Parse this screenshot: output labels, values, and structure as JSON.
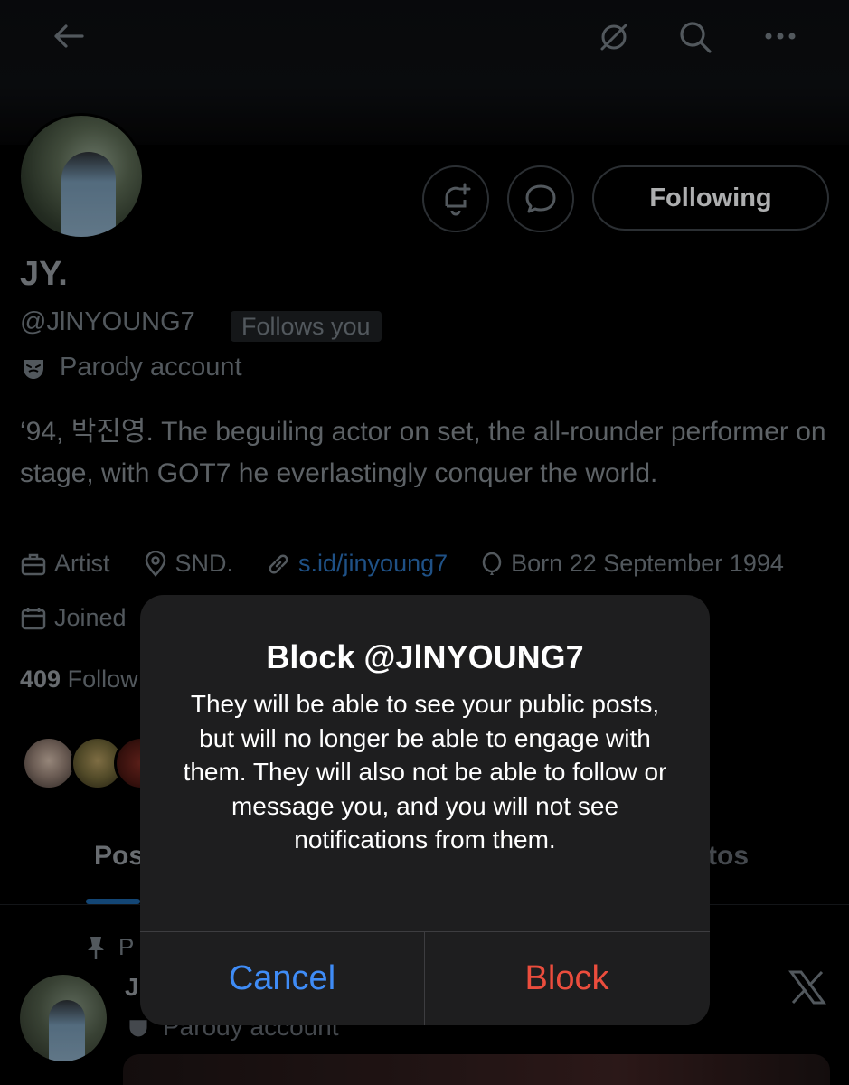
{
  "header": {
    "back_icon": "arrow-left-icon",
    "grok_icon": "slash-circle-icon",
    "search_icon": "search-icon",
    "more_icon": "more-horizontal-icon"
  },
  "profile": {
    "name": "JY.",
    "handle": "@JlNYOUNG7",
    "follows_you": "Follows you",
    "parody_label": "Parody account",
    "bio": "‘94, 박진영. The beguiling actor on set, the all-rounder performer on stage, with GOT7 he everlastingly conquer the world.",
    "following_label": "Following",
    "meta": {
      "category": "Artist",
      "location": "SND.",
      "link": "s.id/jinyoung7",
      "born": "Born 22 September 1994",
      "joined_partial": "Joined"
    },
    "followers_count": "409",
    "followers_label_partial": "Follow"
  },
  "tabs": {
    "posts_partial": "Pos",
    "photos_partial": "tos"
  },
  "pinned_post": {
    "pinned_partial": "P",
    "name_partial": "J",
    "parody_label": "Parody account"
  },
  "dialog": {
    "title": "Block @JlNYOUNG7",
    "message": "They will be able to see your public posts, but will no longer be able to engage with them. They will also not be able to follow or message you, and you will not see notifications from them.",
    "cancel_label": "Cancel",
    "block_label": "Block"
  },
  "colors": {
    "accent_blue": "#3f8cf6",
    "destructive_red": "#eb4d3d",
    "link_blue": "#2a6db3"
  }
}
